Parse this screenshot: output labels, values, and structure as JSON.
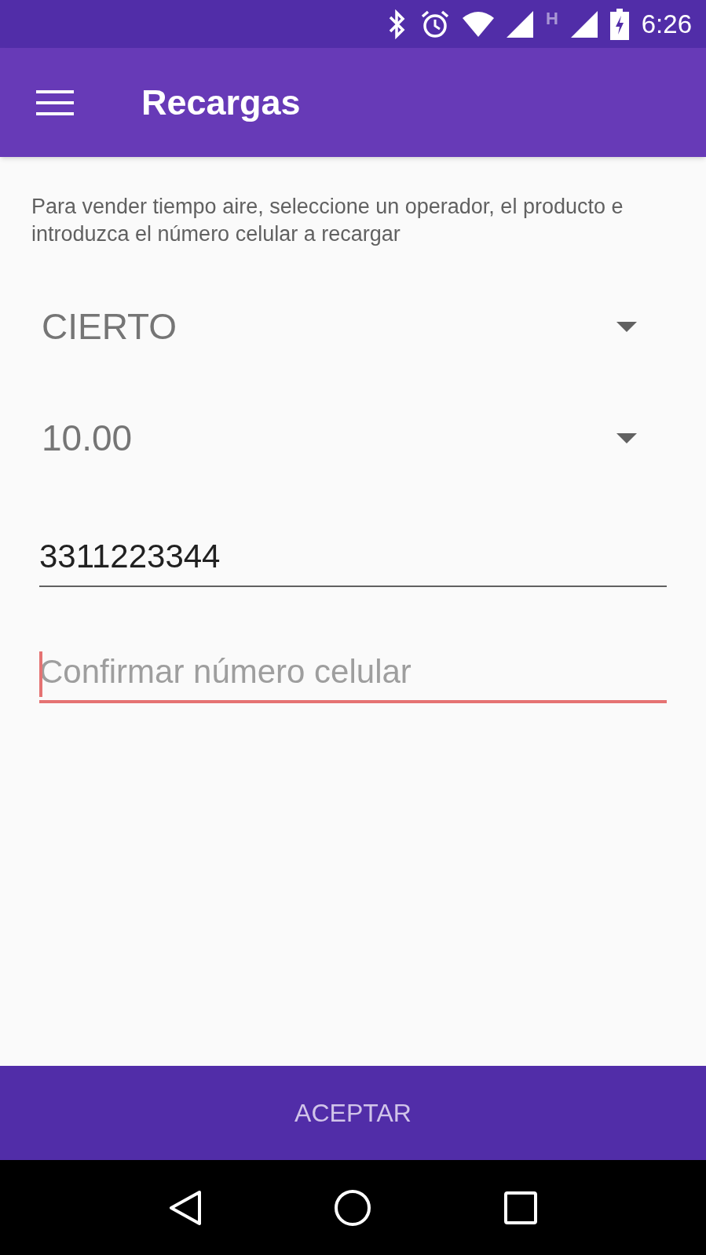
{
  "status_bar": {
    "network_type": "H",
    "time": "6:26"
  },
  "app_bar": {
    "title": "Recargas"
  },
  "instructions": "Para vender tiempo aire, seleccione un operador, el producto e introduzca el número celular a recargar",
  "dropdowns": [
    {
      "value": "CIERTO"
    },
    {
      "value": "10.00"
    }
  ],
  "fields": [
    {
      "value": "3311223344",
      "focused": false
    },
    {
      "placeholder": "Confirmar número celular",
      "focused": true
    }
  ],
  "button": "ACEPTAR"
}
